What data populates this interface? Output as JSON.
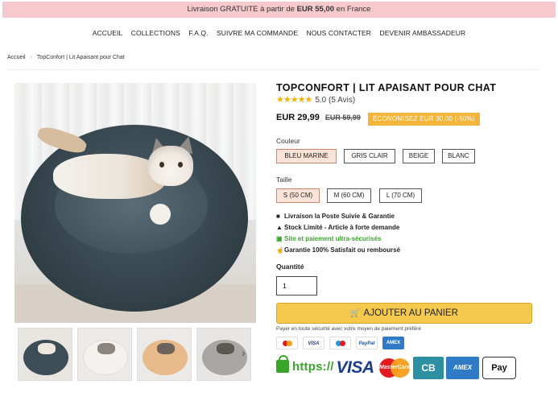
{
  "announcement": {
    "prefix": "Livraison GRATUITE à partir de ",
    "amount": "EUR 55,00",
    "suffix": " en France"
  },
  "nav": [
    "ACCUEIL",
    "COLLECTIONS",
    "F.A.Q.",
    "SUIVRE MA COMMANDE",
    "NOUS CONTACTER",
    "DEVENIR AMBASSADEUR"
  ],
  "breadcrumb": {
    "home": "Accueil",
    "separator": "›",
    "current": "TopConfort | Lit Apaisant pour Chat"
  },
  "product": {
    "title": "TOPCONFORT | LIT APAISANT POUR CHAT",
    "stars": "★★★★★",
    "rating": "5.0 (5 Avis)",
    "price": "EUR 29,99",
    "old_price": "EUR 59,99",
    "savings": "ÉCONOMISEZ EUR 30,00 (-50%)"
  },
  "color": {
    "label": "Couleur",
    "options": [
      "BLEU MARINE",
      "GRIS CLAIR",
      "BEIGE",
      "BLANC"
    ],
    "selected": "BLEU MARINE"
  },
  "size": {
    "label": "Taille",
    "options": [
      "S (50 CM)",
      "M (60 CM)",
      "L (70 CM)"
    ],
    "selected": "S (50 CM)"
  },
  "features": [
    {
      "icon": "truck-icon",
      "text": "Livraison la Poste Suivie & Garantie"
    },
    {
      "icon": "warning-icon",
      "text": "Stock Limité - Article à forte demande"
    },
    {
      "icon": "card-icon",
      "text": "Site et paiement ultra-sécurisés"
    },
    {
      "icon": "thumbs-up-icon",
      "text": "Garantie 100% Satisfait ou remboursé"
    }
  ],
  "quantity": {
    "label": "Quantité",
    "value": "1"
  },
  "cart": {
    "label": "AJOUTER AU PANIER",
    "icon": "cart-icon"
  },
  "payment": {
    "note": "Payer en toute sécurité avec votre moyen de paiement préféré",
    "mini_cards": [
      "mastercard",
      "VISA",
      "maestro",
      "PayPal",
      "AMEX"
    ],
    "secure_text": "https://",
    "visa": "VISA",
    "mastercard": "MasterCard",
    "cb": "CB",
    "amex": "AMEX",
    "apple_pay": " Pay"
  },
  "colors": {
    "announcement_bg": "#f6c9cc",
    "accent_gold": "#f5c94c",
    "savings_badge": "#f4b43a",
    "stars": "#f0b400",
    "secure_green": "#3aa52b",
    "selected_option_bg": "#fbe3d8"
  }
}
